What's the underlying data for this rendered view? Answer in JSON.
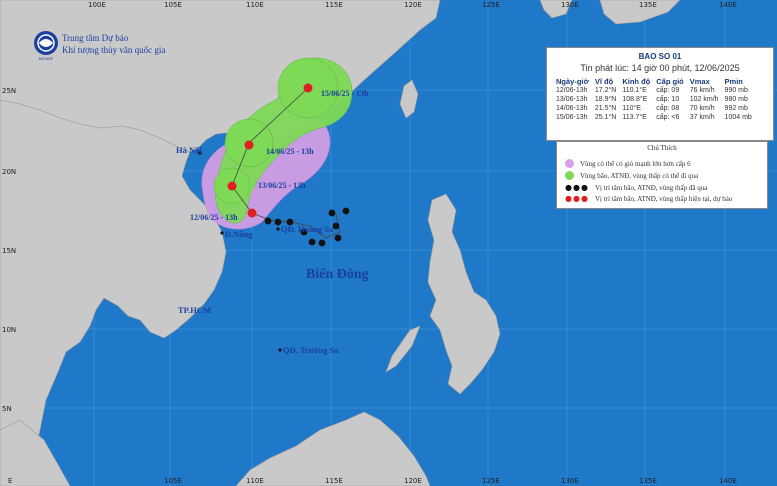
{
  "agency": {
    "line1": "Trung tâm Dự báo",
    "line2": "Khí tượng thủy văn quốc gia",
    "logo_text": "NCHMF"
  },
  "info": {
    "title": "BAO SO 01",
    "subtitle": "Tin phát lúc: 14 giờ 00 phút, 12/06/2025",
    "headers": [
      "Ngày-giờ",
      "Vĩ độ",
      "Kinh độ",
      "Cấp gió",
      "Vmax",
      "Pmin"
    ],
    "rows": [
      [
        "12/06-13h",
        "17.2°N",
        "110.1°E",
        "cấp: 09",
        "76 km/h",
        "990 mb"
      ],
      [
        "13/06-13h",
        "18.9°N",
        "108.8°E",
        "cấp: 10",
        "102 km/h",
        "980 mb"
      ],
      [
        "14/06-13h",
        "21.5°N",
        "110°E",
        "cấp: 08",
        "70 km/h",
        "992 mb"
      ],
      [
        "15/06-13h",
        "25.1°N",
        "113.7°E",
        "cấp: <6",
        "37 km/h",
        "1004 mb"
      ]
    ]
  },
  "legend": {
    "title": "Chú Thích",
    "items": [
      {
        "text": "Vùng có thể có gió mạnh lớn hơn cấp 6",
        "color": "#d9a0e6"
      },
      {
        "text": "Vùng bão, ATNĐ, vùng thấp có thể đi qua",
        "color": "#7ed957"
      },
      {
        "text": "Vị trí tâm bão, ATNĐ, vùng thấp đã qua",
        "color": "#111111"
      },
      {
        "text": "Vị trí tâm bão, ATNĐ, vùng thấp hiện tại, dự báo",
        "color": "#e02020"
      }
    ]
  },
  "map_labels": {
    "hanoi": "Hà Nội",
    "danang": "Đ.Nẵng",
    "hcm": "TP.HCM",
    "hoangsa": "QĐ. Hoàng Sa",
    "truongsa": "QĐ. Trường Sa",
    "sea": "Biển Đông",
    "f1": "15/06/25 - 13h",
    "f2": "14/06/25 - 13h",
    "f3": "13/06/25 - 13h",
    "f4": "12/06/25 - 13h"
  },
  "lon_ticks": [
    "100E",
    "105E",
    "110E",
    "115E",
    "120E",
    "125E",
    "130E",
    "135E",
    "140E"
  ],
  "lat_ticks": [
    "25N",
    "20N",
    "15N",
    "10N",
    "5N"
  ],
  "corner_label": "E",
  "colors": {
    "sea": "#1f78c8",
    "land": "#c9c9c9",
    "wind_zone": "#d9a0e6",
    "track_cone": "#7ed957",
    "current": "#e02020"
  }
}
